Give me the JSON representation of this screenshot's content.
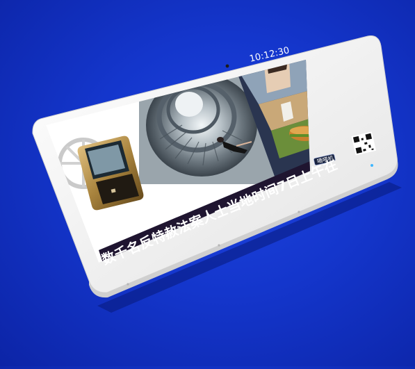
{
  "screen": {
    "clock": "10:12:30",
    "ticker": "数千名反特赦法案人士当地时间7日上午在",
    "promo_button": "嘀嗒机"
  },
  "colors": {
    "background": "#1436cc",
    "bezel": "#f4f4f4",
    "ticker_bar": "#1f1530"
  },
  "icons": {
    "camera": "camera-icon",
    "indicator": "power-indicator-icon",
    "qr": "qr-code-icon"
  }
}
